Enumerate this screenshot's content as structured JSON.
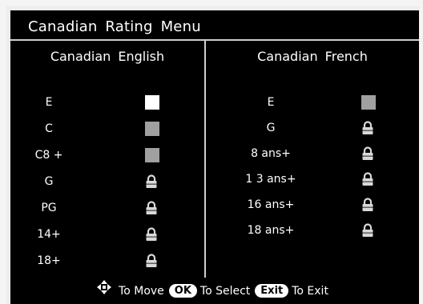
{
  "title": "Canadian Rating Menu",
  "english": {
    "heading": "Canadian English",
    "rows": [
      {
        "label": "E",
        "state": "unlocked-selected"
      },
      {
        "label": "C",
        "state": "unlocked"
      },
      {
        "label": "C8 +",
        "state": "unlocked"
      },
      {
        "label": "G",
        "state": "locked"
      },
      {
        "label": "PG",
        "state": "locked"
      },
      {
        "label": "14+",
        "state": "locked"
      },
      {
        "label": "18+",
        "state": "locked"
      }
    ]
  },
  "french": {
    "heading": "Canadian French",
    "rows": [
      {
        "label": "E",
        "state": "unlocked"
      },
      {
        "label": "G",
        "state": "locked"
      },
      {
        "label": "8 ans+",
        "state": "locked"
      },
      {
        "label": "1 3 ans+",
        "state": "locked"
      },
      {
        "label": "16 ans+",
        "state": "locked"
      },
      {
        "label": "18 ans+",
        "state": "locked"
      }
    ]
  },
  "footer": {
    "move_icon": "dpad-arrows-icon",
    "move_text": "To Move",
    "ok_key": "OK",
    "select_text": "To Select",
    "exit_key": "Exit",
    "exit_text": "To Exit"
  },
  "colors": {
    "background": "#000000",
    "text": "#ffffff",
    "selected_box": "#ffffff",
    "unlocked_box": "#a0a0a0",
    "lock": "#d8d8d8"
  }
}
